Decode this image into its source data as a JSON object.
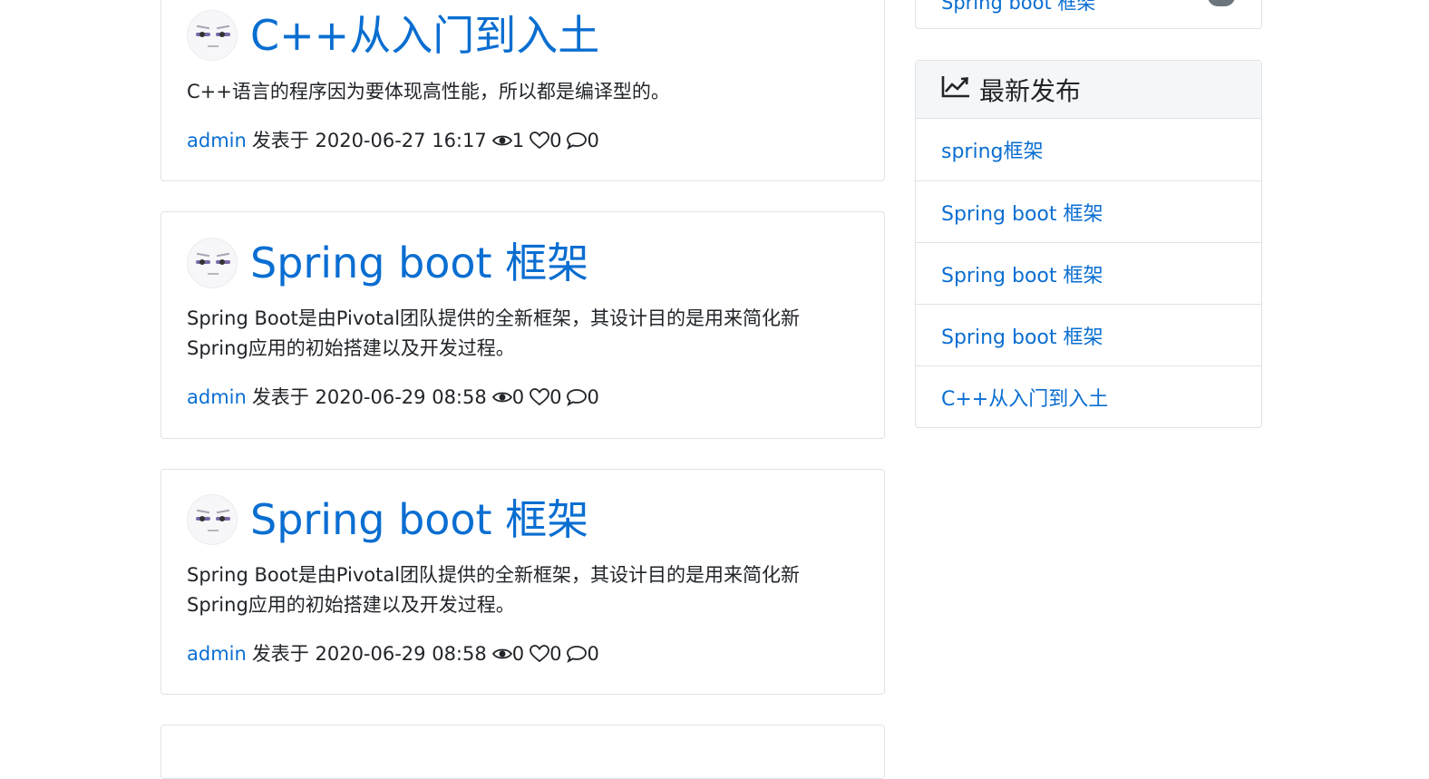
{
  "posts": [
    {
      "title": "C++从入门到入土",
      "summary": "C++语言的程序因为要体现高性能，所以都是编译型的。",
      "author": "admin",
      "posted_label": "发表于 2020-06-27 16:17",
      "views": "1",
      "likes": "0",
      "comments": "0"
    },
    {
      "title": "Spring boot 框架",
      "summary": "Spring Boot是由Pivotal团队提供的全新框架，其设计目的是用来简化新Spring应用的初始搭建以及开发过程。",
      "author": "admin",
      "posted_label": "发表于 2020-06-29 08:58",
      "views": "0",
      "likes": "0",
      "comments": "0"
    },
    {
      "title": "Spring boot 框架",
      "summary": "Spring Boot是由Pivotal团队提供的全新框架，其设计目的是用来简化新Spring应用的初始搭建以及开发过程。",
      "author": "admin",
      "posted_label": "发表于 2020-06-29 08:58",
      "views": "0",
      "likes": "0",
      "comments": "0"
    }
  ],
  "sidebar": {
    "top_item": "Spring boot 框架",
    "latest": {
      "heading": "最新发布",
      "icon": "chart-line-icon",
      "items": [
        "spring框架",
        "Spring boot 框架",
        "Spring boot 框架",
        "Spring boot 框架",
        "C++从入门到入土"
      ]
    }
  },
  "colors": {
    "link": "#0a6ed1",
    "text": "#212529",
    "border": "#dfe3e6",
    "header_bg": "#f5f6f7"
  }
}
